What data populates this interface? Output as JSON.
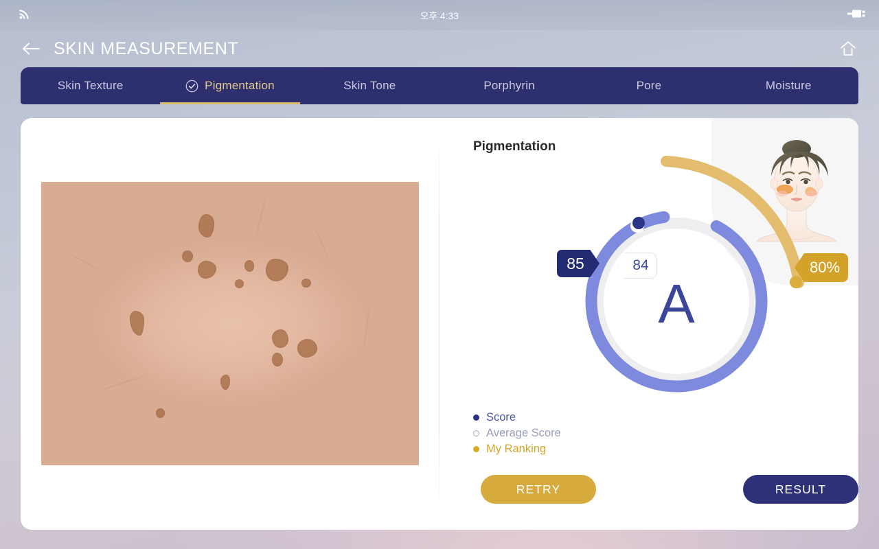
{
  "statusbar": {
    "signal_icon": "wifi-icon",
    "time": "오후 4:33",
    "battery_icon": "usb-battery-icon"
  },
  "header": {
    "back_icon": "back-arrow-icon",
    "title": "SKIN MEASUREMENT",
    "home_icon": "home-icon"
  },
  "tabs": [
    {
      "label": "Skin Texture",
      "active": false
    },
    {
      "label": "Pigmentation",
      "active": true,
      "icon": "check-circle-icon"
    },
    {
      "label": "Skin Tone",
      "active": false
    },
    {
      "label": "Porphyrin",
      "active": false
    },
    {
      "label": "Pore",
      "active": false
    },
    {
      "label": "Moisture",
      "active": false
    }
  ],
  "main": {
    "detail_title": "Pigmentation",
    "skin_image_alt": "skin-microscope-image",
    "face_image_alt": "face-pigmentation-diagram"
  },
  "gauge": {
    "grade": "A",
    "score": "85",
    "average_score": "84",
    "ranking": "80%"
  },
  "legend": [
    {
      "label": "Score",
      "marker": "filled-navy"
    },
    {
      "label": "Average Score",
      "marker": "hollow"
    },
    {
      "label": "My Ranking",
      "marker": "filled-gold"
    }
  ],
  "actions": {
    "retry_label": "RETRY",
    "result_label": "RESULT"
  },
  "chart_data": {
    "type": "gauge",
    "title": "Pigmentation",
    "grade": "A",
    "series": [
      {
        "name": "Score",
        "value": 85,
        "max": 100,
        "color": "#7d8ade"
      },
      {
        "name": "Average Score",
        "value": 84,
        "max": 100,
        "color": "#efefef"
      },
      {
        "name": "My Ranking",
        "value": 80,
        "max": 100,
        "unit": "%",
        "color": "#e0bd6e"
      }
    ],
    "legend_position": "bottom-left"
  },
  "colors": {
    "tabbar_bg": "#2e2f6e",
    "tab_active": "#e2c989",
    "score_ring": "#7d8ade",
    "ring_track": "#efeff1",
    "score_badge": "#232b73",
    "rank_accent": "#d2a229",
    "retry_button": "#d6aa3c",
    "result_button": "#2e3178",
    "grade_text": "#3a459b"
  }
}
